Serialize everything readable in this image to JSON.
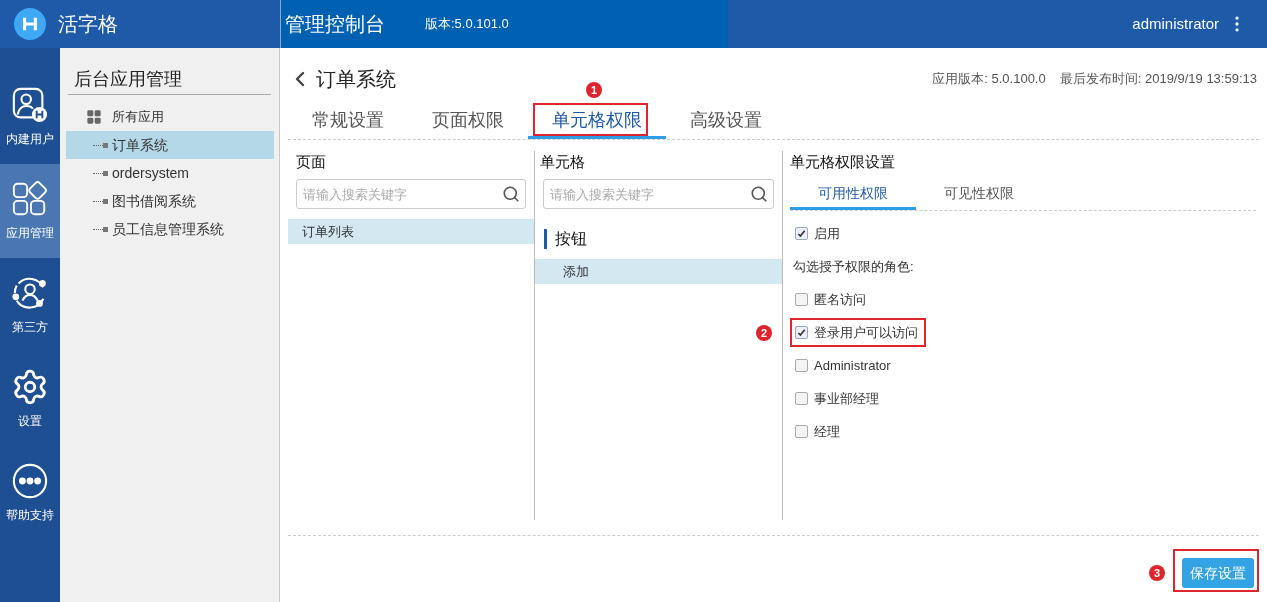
{
  "header": {
    "logo_text": "活字格",
    "title": "管理控制台",
    "version": "版本:5.0.101.0",
    "user": "administrator"
  },
  "nav": [
    {
      "label": "内建用户",
      "kind": "users",
      "selected": false
    },
    {
      "label": "应用管理",
      "kind": "apps",
      "selected": true
    },
    {
      "label": "第三方",
      "kind": "third",
      "selected": false
    },
    {
      "label": "设置",
      "kind": "settings",
      "selected": false
    },
    {
      "label": "帮助支持",
      "kind": "help",
      "selected": false
    }
  ],
  "tree": {
    "title": "后台应用管理",
    "root": {
      "label": "所有应用",
      "children": [
        {
          "label": "订单系统",
          "selected": true
        },
        {
          "label": "ordersystem",
          "selected": false
        },
        {
          "label": "图书借阅系统",
          "selected": false
        },
        {
          "label": "员工信息管理系统",
          "selected": false
        }
      ]
    }
  },
  "app": {
    "title": "订单系统",
    "app_version": "应用版本: 5.0.100.0",
    "publish_time": "最后发布时间: 2019/9/19 13:59:13"
  },
  "tabs": [
    {
      "label": "常规设置",
      "selected": false
    },
    {
      "label": "页面权限",
      "selected": false
    },
    {
      "label": "单元格权限",
      "selected": true,
      "callout": "1"
    },
    {
      "label": "高级设置",
      "selected": false
    }
  ],
  "pages_panel": {
    "title": "页面",
    "placeholder": "请输入搜索关键字",
    "items": [
      {
        "label": "订单列表",
        "selected": true
      }
    ]
  },
  "cells_panel": {
    "title": "单元格",
    "placeholder": "请输入搜索关键字",
    "groups": [
      {
        "label": "按钮",
        "items": [
          {
            "label": "添加",
            "selected": true
          }
        ]
      }
    ]
  },
  "permission_panel": {
    "title": "单元格权限设置",
    "tabs": [
      {
        "label": "可用性权限",
        "selected": true
      },
      {
        "label": "可见性权限",
        "selected": false
      }
    ],
    "enable": {
      "label": "启用",
      "checked": true
    },
    "roles_label": "勾选授予权限的角色:",
    "roles": [
      {
        "label": "匿名访问",
        "checked": false
      },
      {
        "label": "登录用户可以访问",
        "checked": true,
        "callout": "2"
      },
      {
        "label": "Administrator",
        "checked": false
      },
      {
        "label": "事业部经理",
        "checked": false
      },
      {
        "label": "经理",
        "checked": false
      }
    ]
  },
  "save_button": {
    "label": "保存设置",
    "callout": "3"
  }
}
